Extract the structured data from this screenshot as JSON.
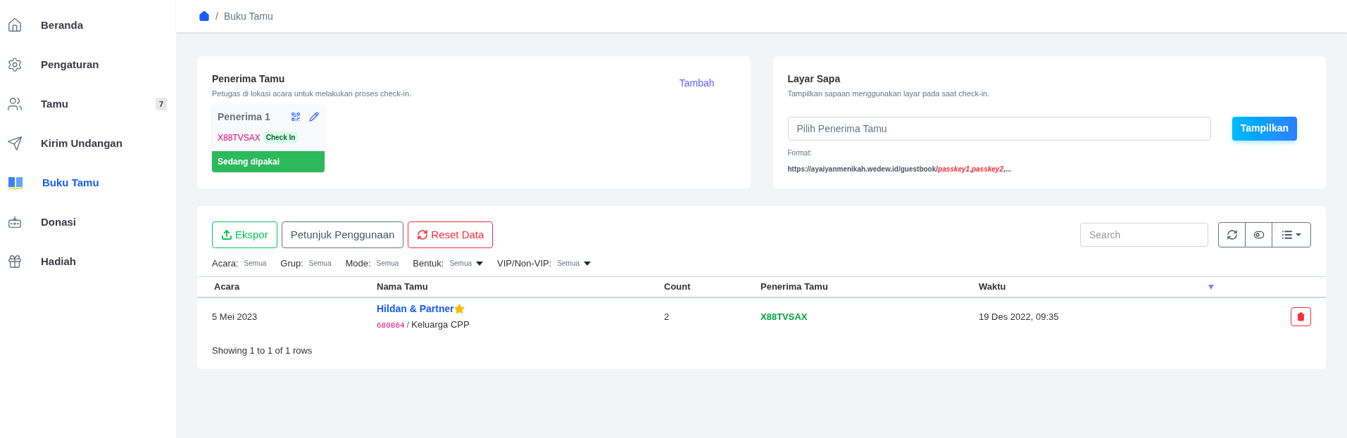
{
  "sidebar": {
    "items": [
      {
        "label": "Beranda",
        "kind": "home",
        "selected": false
      },
      {
        "label": "Pengaturan",
        "kind": "settings",
        "selected": false
      },
      {
        "label": "Tamu",
        "kind": "users",
        "selected": false,
        "badge": "7"
      },
      {
        "label": "Kirim Undangan",
        "kind": "send",
        "selected": false
      },
      {
        "label": "Buku Tamu",
        "kind": "book",
        "selected": true
      },
      {
        "label": "Donasi",
        "kind": "donation",
        "selected": false
      },
      {
        "label": "Hadiah",
        "kind": "gift",
        "selected": false
      }
    ]
  },
  "breadcrumb": {
    "separator": "/",
    "current": "Buku Tamu"
  },
  "receivers": {
    "title": "Penerima Tamu",
    "subtitle": "Petugas di lokasi acara untuk melakukan proses check-in.",
    "add_link": "Tambah",
    "cards": [
      {
        "name": "Penerima 1",
        "passkey": "X88TVSAX",
        "badge": "Check In",
        "status": "Sedang dipakai",
        "in_use": true
      }
    ]
  },
  "greeting_screen": {
    "title": "Layar Sapa",
    "subtitle": "Tampilkan sapaan menggunakan layar pada saat check-in.",
    "select_placeholder": "Pilih Penerima Tamu",
    "button": "Tampilkan",
    "format_label": "Format:",
    "format": "https://ayaiyanmenikah.wedew.id/guestbook/*passkey1*,*passkey2*,..."
  },
  "toolbar": {
    "buttons": [
      {
        "label": "Ekspor",
        "kind": "export"
      },
      {
        "label": "Petunjuk Penggunaan",
        "kind": "help"
      },
      {
        "label": "Reset Data",
        "kind": "reset"
      }
    ],
    "search_placeholder": "Search"
  },
  "filters": [
    {
      "label": "Acara:",
      "value": "Semua",
      "dropdown": false
    },
    {
      "label": "Grup:",
      "value": "Semua",
      "dropdown": false
    },
    {
      "label": "Mode:",
      "value": "Semua",
      "dropdown": false
    },
    {
      "label": "Bentuk:",
      "value": "Semua",
      "dropdown": true
    },
    {
      "label": "VIP/Non-VIP:",
      "value": "Semua",
      "dropdown": true
    }
  ],
  "table": {
    "columns": [
      "Acara",
      "Nama Tamu",
      "Count",
      "Penerima Tamu",
      "Waktu"
    ],
    "rows": [
      {
        "event": "5 Mei 2023",
        "guest": "Hildan & Partner",
        "vip": true,
        "code": "680864",
        "separator": "/",
        "group": "Keluarga CPP",
        "count": "2",
        "receiver": "X88TVSAX",
        "time": "19 Des 2022, 09:35"
      }
    ],
    "footer": "Showing 1 to 1 of 1 rows"
  }
}
